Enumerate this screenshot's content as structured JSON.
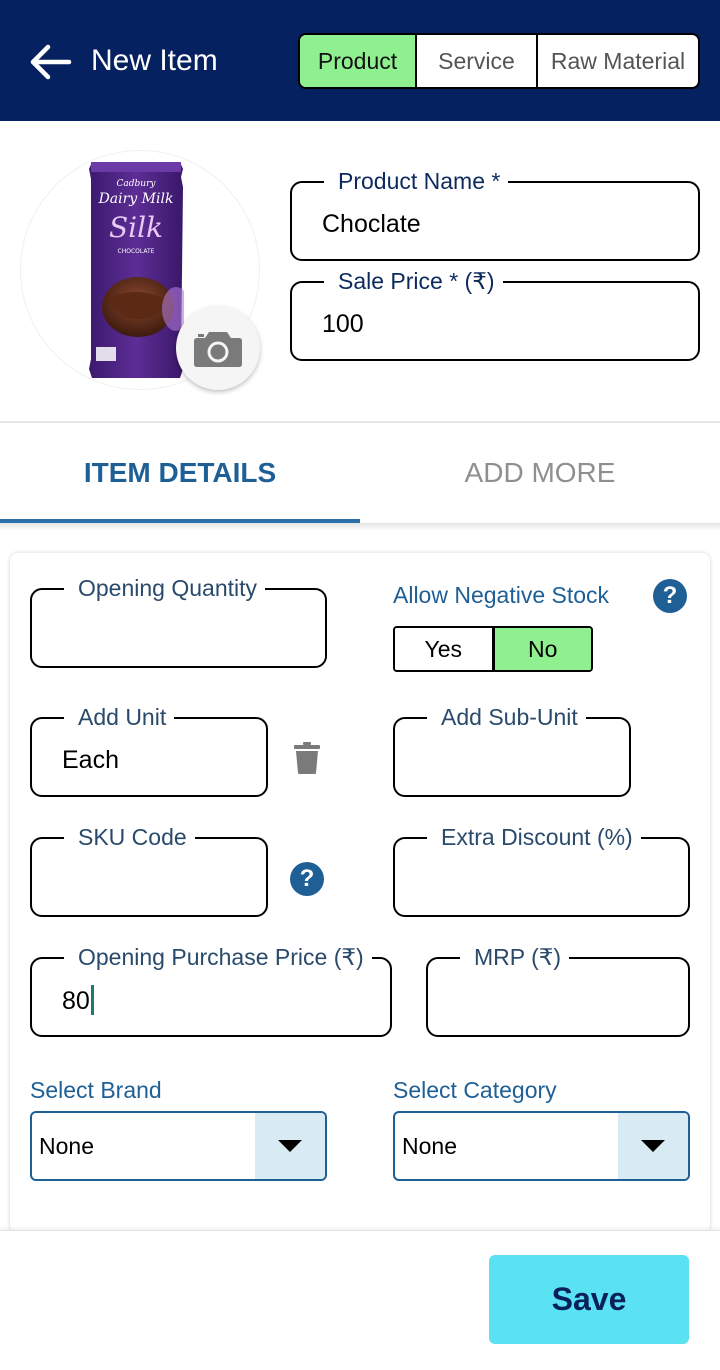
{
  "header": {
    "title": "New Item",
    "item_types": [
      "Product",
      "Service",
      "Raw Material"
    ],
    "selected_type": "Product"
  },
  "product_image": {
    "brand": "Cadbury",
    "name_line1": "Dairy Milk",
    "name_line2": "Silk",
    "flavor": "CHOCOLATE"
  },
  "product_name": {
    "label": "Product Name *",
    "value": "Choclate"
  },
  "sale_price": {
    "label": "Sale Price * (₹)",
    "value": "100"
  },
  "tabs": {
    "item_details": "ITEM DETAILS",
    "add_more": "ADD MORE",
    "active": "ITEM DETAILS"
  },
  "form": {
    "opening_quantity": {
      "label": "Opening Quantity",
      "value": ""
    },
    "allow_negative_stock": {
      "label": "Allow Negative Stock",
      "yes": "Yes",
      "no": "No",
      "selected": "No"
    },
    "add_unit": {
      "label": "Add Unit",
      "value": "Each"
    },
    "add_sub_unit": {
      "label": "Add Sub-Unit",
      "value": ""
    },
    "sku_code": {
      "label": "SKU Code",
      "value": ""
    },
    "extra_discount": {
      "label": "Extra Discount (%)",
      "value": ""
    },
    "opening_purchase_price": {
      "label": "Opening Purchase Price (₹)",
      "value": "80"
    },
    "mrp": {
      "label": "MRP (₹)",
      "value": ""
    },
    "brand": {
      "label": "Select Brand",
      "value": "None"
    },
    "category": {
      "label": "Select Category",
      "value": "None"
    }
  },
  "footer": {
    "save_label": "Save"
  },
  "colors": {
    "header_bg": "#06215f",
    "active_green": "#8ff08f",
    "accent_blue": "#1e5f96",
    "save_bg": "#5ae1f2"
  }
}
